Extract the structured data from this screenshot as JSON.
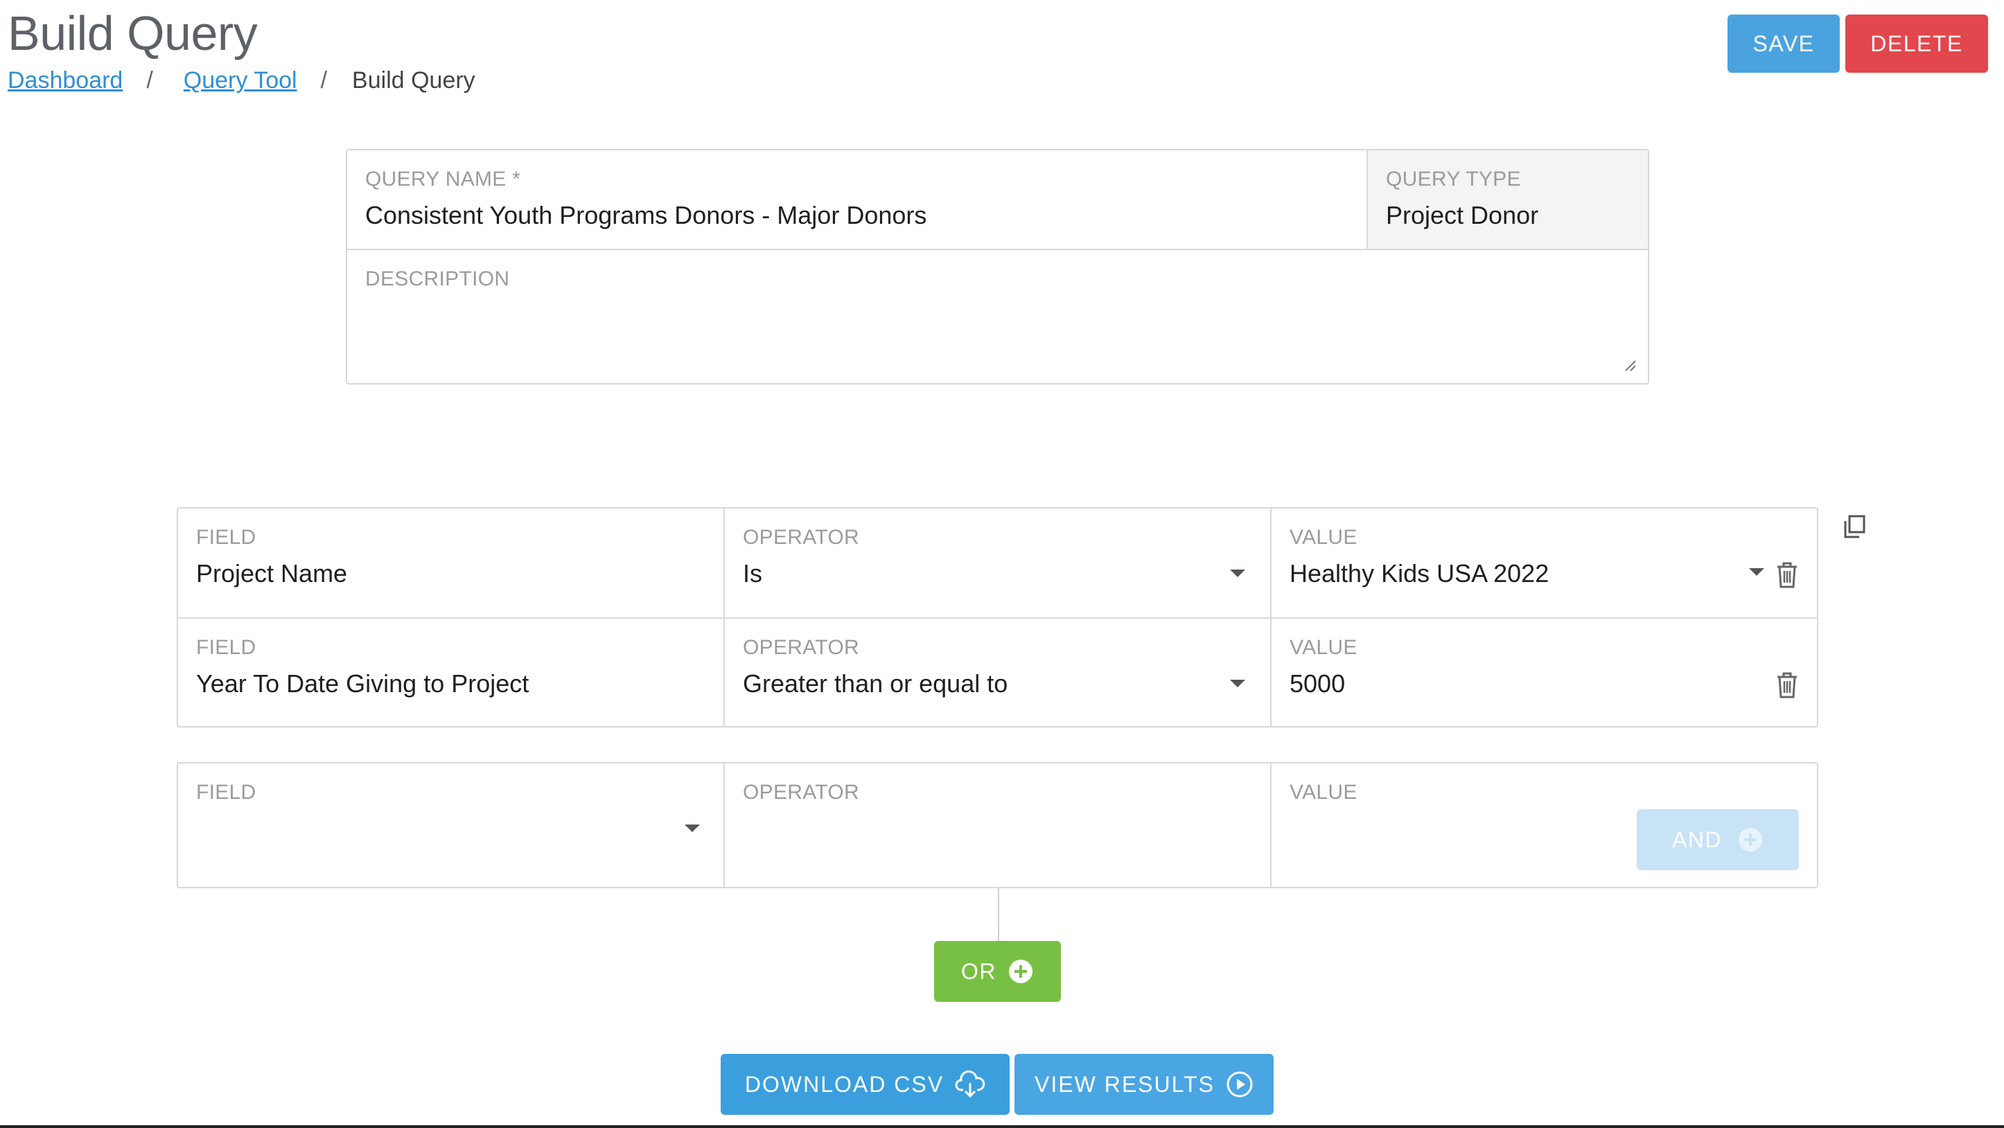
{
  "header": {
    "title": "Build Query",
    "breadcrumb": {
      "items": [
        "Dashboard",
        "Query Tool"
      ],
      "separator": "/",
      "current": "Build Query"
    },
    "save_label": "SAVE",
    "delete_label": "DELETE"
  },
  "query": {
    "name_label": "QUERY NAME *",
    "name_value": "Consistent Youth Programs Donors - Major Donors",
    "type_label": "QUERY TYPE",
    "type_value": "Project Donor",
    "description_label": "DESCRIPTION",
    "description_value": ""
  },
  "rules": [
    {
      "field_label": "FIELD",
      "field_value": "Project Name",
      "operator_label": "OPERATOR",
      "operator_value": "Is",
      "value_label": "VALUE",
      "value_value": "Healthy Kids USA 2022"
    },
    {
      "field_label": "FIELD",
      "field_value": "Year To Date Giving to Project",
      "operator_label": "OPERATOR",
      "operator_value": "Greater than or equal to",
      "value_label": "VALUE",
      "value_value": "5000"
    }
  ],
  "new_rule": {
    "field_label": "FIELD",
    "operator_label": "OPERATOR",
    "value_label": "VALUE",
    "and_label": "AND"
  },
  "actions": {
    "or_label": "OR",
    "download_label": "DOWNLOAD CSV",
    "view_label": "VIEW RESULTS"
  },
  "colors": {
    "save": "#4aa3df",
    "delete": "#e2474d",
    "or": "#78c043",
    "and_disabled": "#c8e3f6",
    "link": "#2f8fd4"
  },
  "icons": [
    "copy-icon",
    "trash-icon",
    "caret-down-icon",
    "plus-circle-icon",
    "cloud-download-icon",
    "play-circle-icon",
    "resize-grip-icon"
  ]
}
